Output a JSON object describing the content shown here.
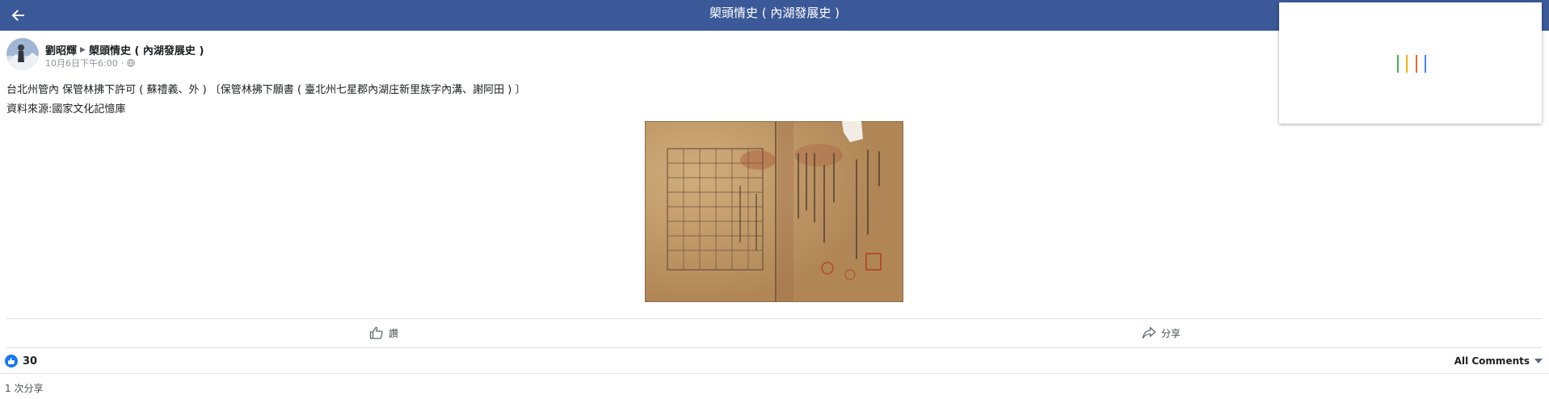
{
  "topbar": {
    "title": "㮾頭情史 ( 內湖發展史 )",
    "background": "#3b5998"
  },
  "icons": {
    "back": "arrow-left-icon",
    "like": "thumbs-up-icon",
    "share": "share-arrow-icon",
    "audience": "globe-icon",
    "reaction": "like-reaction-icon",
    "dropdown": "caret-down-icon"
  },
  "loader": {
    "bar_colors": [
      "#4caf50",
      "#f4b400",
      "#e66b2e",
      "#4285f4"
    ]
  },
  "post": {
    "author": "劉昭輝",
    "group": "㮾頭情史 ( 內湖發展史 )",
    "timestamp": "10月6日下午6:00",
    "separator": "·",
    "text_line1": "台北州管內 保管林拂下許可 ( 蘇禮義、外 ) 〔保管林拂下願書 ( 臺北州七星郡內湖庄新里族字內溝、謝阿田 ) 〕",
    "text_line2": "資料來源:國家文化記憶庫"
  },
  "actions": {
    "like_label": "讚",
    "share_label": "分享"
  },
  "reactions": {
    "count": "30",
    "badge_color": "#1877f2"
  },
  "comments_filter": {
    "label": "All Comments"
  },
  "shares": {
    "text": "1 次分享"
  }
}
